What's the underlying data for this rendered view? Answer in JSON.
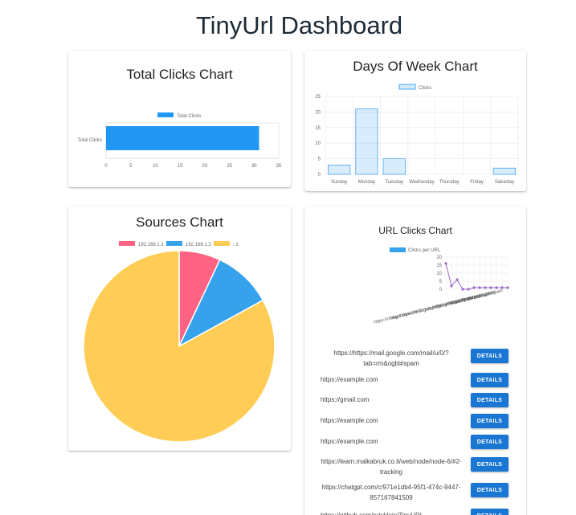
{
  "page": {
    "title": "TinyUrl Dashboard"
  },
  "colors": {
    "primary": "#1976d2",
    "blue": "#2196f3",
    "pink": "#ff6384",
    "lightblue": "#36a2eb",
    "yellow": "#ffcd56",
    "purple": "#9c68c6"
  },
  "cards": {
    "total_clicks": {
      "title": "Total Clicks Chart"
    },
    "days_of_week": {
      "title": "Days Of Week Chart"
    },
    "sources": {
      "title": "Sources Chart"
    },
    "url_clicks": {
      "title": "URL Clicks Chart"
    }
  },
  "chart_data": [
    {
      "type": "bar",
      "orientation": "horizontal",
      "title": "Total Clicks Chart",
      "categories": [
        "Total Clicks"
      ],
      "series": [
        {
          "name": "Total Clicks",
          "values": [
            31
          ]
        }
      ],
      "xlim": [
        0,
        35
      ],
      "xticks": [
        "0",
        "5",
        "10",
        "15",
        "20",
        "25",
        "30",
        "35"
      ],
      "legend": "top"
    },
    {
      "type": "bar",
      "title": "Days Of Week Chart",
      "categories": [
        "Sunday",
        "Monday",
        "Tuesday",
        "Wednesday",
        "Thursday",
        "Friday",
        "Saturday"
      ],
      "series": [
        {
          "name": "Clicks",
          "values": [
            3,
            21,
            5,
            0,
            0,
            0,
            2
          ]
        }
      ],
      "ylim": [
        0,
        25
      ],
      "yticks": [
        "0",
        "5",
        "10",
        "15",
        "20",
        "25"
      ],
      "grid": true,
      "legend": "top"
    },
    {
      "type": "pie",
      "title": "Sources Chart",
      "labels": [
        "192.168.1.1",
        "192.168.1.2",
        "::1"
      ],
      "values": [
        7,
        10,
        83
      ],
      "colors": [
        "#ff6384",
        "#36a2eb",
        "#ffcd56"
      ],
      "legend": "top"
    },
    {
      "type": "line",
      "title": "URL Clicks Chart",
      "series": [
        {
          "name": "Clicks per URL",
          "values": [
            16,
            2,
            6,
            0,
            0,
            1,
            1,
            1,
            1,
            1,
            1,
            1
          ]
        }
      ],
      "ylim": [
        0,
        20
      ],
      "yticks": [
        "0",
        "5",
        "10",
        "15",
        "20"
      ],
      "x_labels_visible": [
        "http://https://mail.google.com/mail/u/0/?tab=rm&ogbl#spam",
        "https://chatgpt.com/c/971e1db4-95f1-474c-9447-857167841509",
        "https://example.com",
        "https://gmail.com",
        "http://github.com/rzbm"
      ],
      "grid": true,
      "legend": "top"
    }
  ],
  "url_list": [
    {
      "url": "https://https://mail.google.com/mail/u/0/?tab=rm&ogbl#spam",
      "button": "DETAILS"
    },
    {
      "url": "https://example.com",
      "button": "DETAILS"
    },
    {
      "url": "https://gmail.com",
      "button": "DETAILS"
    },
    {
      "url": "https://example.com",
      "button": "DETAILS"
    },
    {
      "url": "https://example.com",
      "button": "DETAILS"
    },
    {
      "url": "https://learn.malkabruk.co.il/web/node/node-6/#2-tracking",
      "button": "DETAILS"
    },
    {
      "url": "https://chatgpt.com/c/971e1db4-95f1-474c-9447-857167841509",
      "button": "DETAILS"
    },
    {
      "url": "https://github.com/rutyklein/TinyURL",
      "button": "DETAILS"
    }
  ]
}
